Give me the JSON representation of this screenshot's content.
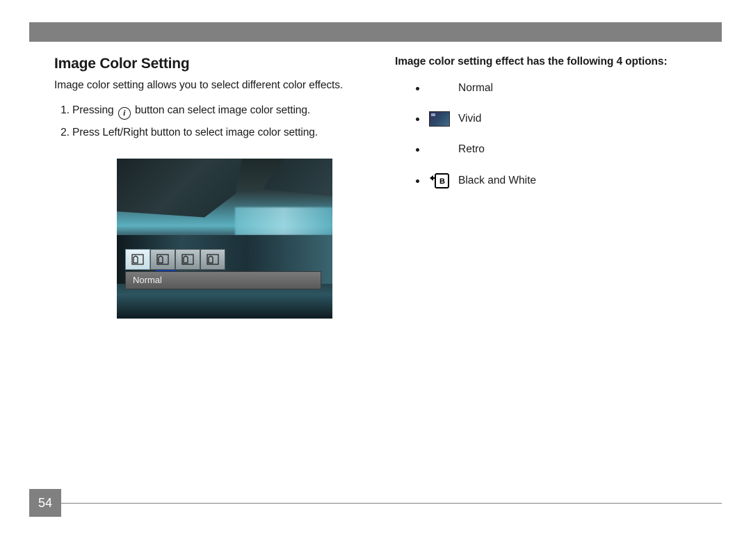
{
  "page_number": "54",
  "heading": "Image Color Setting",
  "intro": "Image color setting allows you to select different color effects.",
  "step1_pre": "Pressing",
  "step1_post": "button can select image color setting.",
  "step2": "Press Left/Right button to select image color setting.",
  "camera_overlay_label": "Normal",
  "options_intro": "Image color setting effect has the following 4 options:",
  "options": {
    "o1": "Normal",
    "o2": "Vivid",
    "o3": "Retro",
    "o4": "Black and White"
  }
}
